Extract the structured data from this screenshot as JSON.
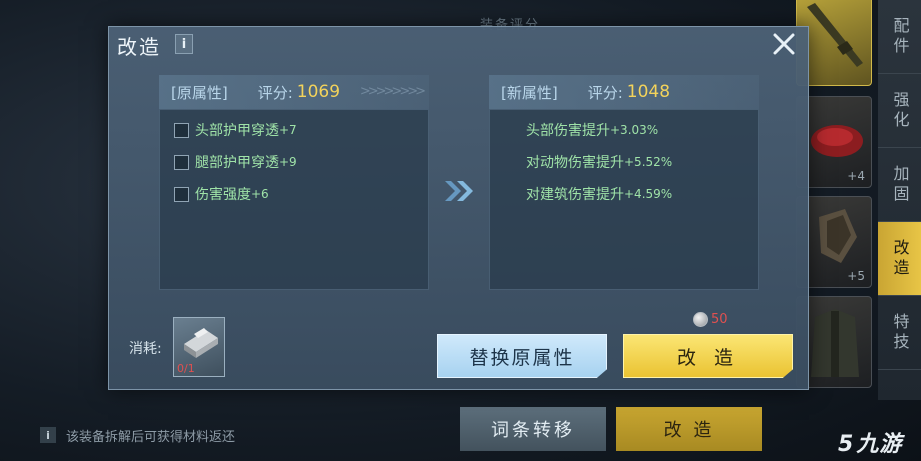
{
  "background": {
    "title": "装备评分",
    "slots": [
      {
        "count": ""
      },
      {
        "count": "+4"
      },
      {
        "count": "+5"
      },
      {
        "count": ""
      }
    ],
    "side_tabs": [
      {
        "label": "配件",
        "active": false
      },
      {
        "label": "强化",
        "active": false
      },
      {
        "label": "加固",
        "active": false
      },
      {
        "label": "改造",
        "active": true
      },
      {
        "label": "特技",
        "active": false
      }
    ],
    "transfer_button": "词条转移",
    "modify_button": "改 造",
    "hint": "该装备拆解后可获得材料返还",
    "hint_icon": "i",
    "logo": "九游",
    "logo_mark": "5"
  },
  "modal": {
    "title": "改造",
    "info_icon": "i",
    "original": {
      "label": "[原属性]",
      "score_label": "评分:",
      "score": "1069",
      "attributes": [
        {
          "name": "头部护甲穿透",
          "bonus": "+7"
        },
        {
          "name": "腿部护甲穿透",
          "bonus": "+9"
        },
        {
          "name": "伤害强度",
          "bonus": "+6"
        }
      ]
    },
    "new": {
      "label": "[新属性]",
      "score_label": "评分:",
      "score": "1048",
      "attributes": [
        {
          "name": "头部伤害提升",
          "bonus": "+3.03%"
        },
        {
          "name": "对动物伤害提升",
          "bonus": "+5.52%"
        },
        {
          "name": "对建筑伤害提升",
          "bonus": "+4.59%"
        }
      ]
    },
    "cost_label": "消耗:",
    "material_count": "0/1",
    "coin_cost": "50",
    "replace_button": "替换原属性",
    "confirm_button": "改 造",
    "colors": {
      "score": "#f3d35b",
      "attribute": "#9fe3a8",
      "insufficient": "#e05050",
      "confirm": "#eac332",
      "replace": "#a7d2f0"
    }
  }
}
